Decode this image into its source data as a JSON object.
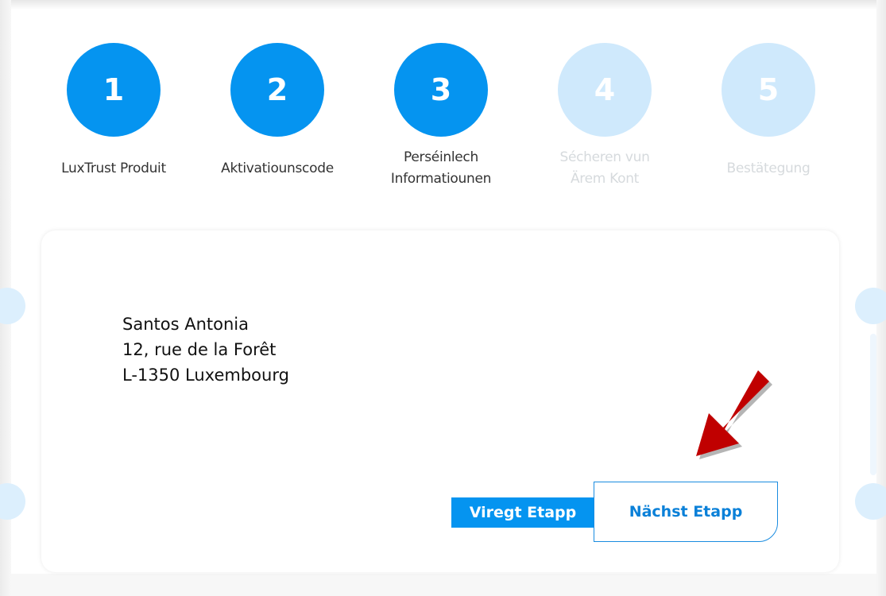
{
  "stepper": {
    "steps": [
      {
        "number": "1",
        "label_lines": [
          "LuxTrust Produit"
        ],
        "state": "completed"
      },
      {
        "number": "2",
        "label_lines": [
          "Aktivatiounscode"
        ],
        "state": "completed"
      },
      {
        "number": "3",
        "label_lines": [
          "Perséinlech",
          "Informatiounen"
        ],
        "state": "current"
      },
      {
        "number": "4",
        "label_lines": [
          "Sécheren vun",
          "Ärem Kont"
        ],
        "state": "upcoming"
      },
      {
        "number": "5",
        "label_lines": [
          "Bestätegung"
        ],
        "state": "upcoming"
      }
    ]
  },
  "card": {
    "address": {
      "name": "Santos Antonia",
      "street": "12, rue de la Forêt",
      "city": "L-1350 Luxembourg"
    }
  },
  "buttons": {
    "previous_label": "Viregt Etapp",
    "next_label": "Nächst Etapp"
  },
  "colors": {
    "accent": "#0594f0",
    "inactive_step": "#cfe9fc",
    "annotation_arrow": "#c00000"
  },
  "icons": {
    "annotation": "arrow-down-left-icon"
  }
}
